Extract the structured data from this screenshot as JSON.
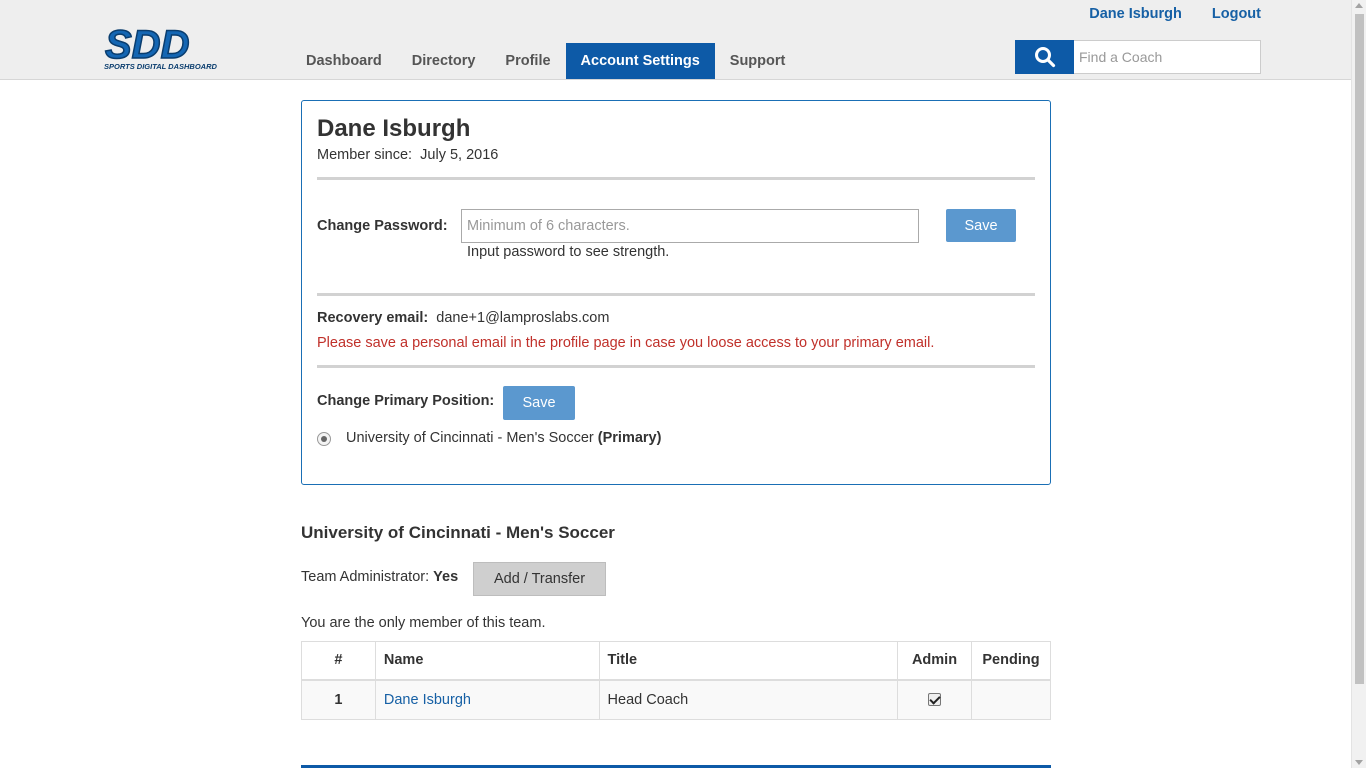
{
  "header": {
    "logo_alt": "SDD Sports Digital Dashboard",
    "logo_text": "SDD",
    "logo_tagline": "SPORTS DIGITAL DASHBOARD",
    "nav": [
      {
        "label": "Dashboard",
        "active": false
      },
      {
        "label": "Directory",
        "active": false
      },
      {
        "label": "Profile",
        "active": false
      },
      {
        "label": "Account Settings",
        "active": true
      },
      {
        "label": "Support",
        "active": false
      }
    ],
    "user_link": "Dane Isburgh",
    "logout_link": "Logout",
    "search": {
      "placeholder": "Find a Coach",
      "icon": "search-icon"
    }
  },
  "account": {
    "name": "Dane Isburgh",
    "member_since_label": "Member since:",
    "member_since_date": "July 5, 2016",
    "change_password_label": "Change Password:",
    "password_placeholder": "Minimum of 6 characters.",
    "save_label": "Save",
    "strength_text": "Input password to see strength.",
    "recovery_label": "Recovery email:",
    "recovery_email": "dane+1@lamproslabs.com",
    "warning": "Please save a personal email in the profile page in case you loose access to your primary email.",
    "primary_position_label": "Change Primary Position:",
    "position": "University of Cincinnati - Men's Soccer",
    "position_primary_tag": "(Primary)"
  },
  "team": {
    "title": "University of Cincinnati - Men's Soccer",
    "admin_label": "Team Administrator:",
    "admin_value": "Yes",
    "add_transfer_label": "Add / Transfer",
    "only_member_text": "You are the only member of this team.",
    "columns": [
      "#",
      "Name",
      "Title",
      "Admin",
      "Pending"
    ],
    "rows": [
      {
        "num": "1",
        "name": "Dane Isburgh",
        "title": "Head Coach",
        "admin": true,
        "pending": ""
      }
    ]
  },
  "colors": {
    "brand": "#0d5aa7",
    "button": "#5b98cf",
    "warning": "#c0302a"
  }
}
